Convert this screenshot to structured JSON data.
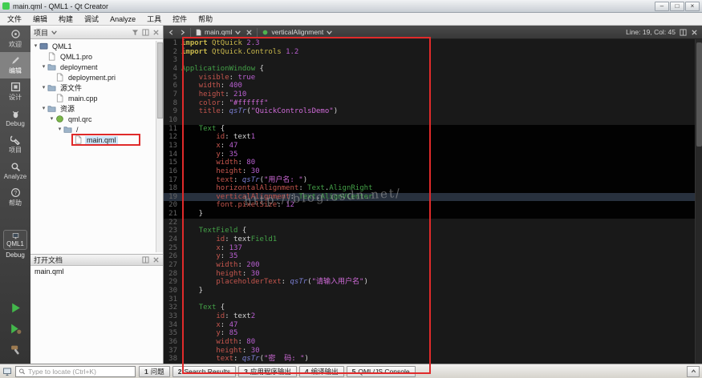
{
  "window": {
    "title": "main.qml - QML1 - Qt Creator",
    "controls": {
      "minimize": "–",
      "maximize": "□",
      "close": "×"
    }
  },
  "colors": {
    "annotation_red": "#e02a2a",
    "qt_green": "#41cd52"
  },
  "menu": {
    "items": [
      "文件",
      "编辑",
      "构建",
      "调试",
      "Analyze",
      "工具",
      "控件",
      "帮助"
    ]
  },
  "modebar": {
    "items": [
      {
        "id": "welcome",
        "label": "欢迎",
        "icon": "welcome",
        "selected": false
      },
      {
        "id": "edit",
        "label": "编辑",
        "icon": "edit",
        "selected": true
      },
      {
        "id": "design",
        "label": "设计",
        "icon": "design",
        "selected": false
      },
      {
        "id": "debug",
        "label": "Debug",
        "icon": "debug",
        "selected": false
      },
      {
        "id": "projects",
        "label": "项目",
        "icon": "projects",
        "selected": false
      },
      {
        "id": "analyze",
        "label": "Analyze",
        "icon": "analyze",
        "selected": false
      },
      {
        "id": "help",
        "label": "帮助",
        "icon": "help",
        "selected": false
      }
    ],
    "kit": {
      "project": "QML1",
      "config": "Debug"
    }
  },
  "project_panel": {
    "title": "项目",
    "tree": [
      {
        "label": "QML1",
        "depth": 0,
        "icon": "project",
        "expanded": true
      },
      {
        "label": "QML1.pro",
        "depth": 1,
        "icon": "file"
      },
      {
        "label": "deployment",
        "depth": 1,
        "icon": "folder",
        "expanded": true
      },
      {
        "label": "deployment.pri",
        "depth": 2,
        "icon": "file"
      },
      {
        "label": "源文件",
        "depth": 1,
        "icon": "folder",
        "expanded": true
      },
      {
        "label": "main.cpp",
        "depth": 2,
        "icon": "file"
      },
      {
        "label": "资源",
        "depth": 1,
        "icon": "folder",
        "expanded": true
      },
      {
        "label": "qml.qrc",
        "depth": 2,
        "icon": "qrc",
        "expanded": true
      },
      {
        "label": "/",
        "depth": 3,
        "icon": "folder",
        "expanded": true
      },
      {
        "label": "main.qml",
        "depth": 4,
        "icon": "file",
        "selected": true,
        "annotated": true
      }
    ],
    "open_docs": {
      "title": "打开文档",
      "items": [
        "main.qml"
      ]
    }
  },
  "editor": {
    "toolbar": {
      "file": "main.qml",
      "symbol": "verticalAlignment",
      "position": "Line: 19, Col: 45"
    },
    "current_line": 19,
    "highlight_block": {
      "from": 11,
      "to": 21
    },
    "watermark": "http://blog.csdn.net/",
    "lines": [
      "import QtQuick 2.3",
      "import QtQuick.Controls 1.2",
      "",
      "ApplicationWindow {",
      "    visible: true",
      "    width: 400",
      "    height: 210",
      "    color: \"#ffffff\"",
      "    title: qsTr(\"QuickControlsDemo\")",
      "",
      "    Text {",
      "        id: text1",
      "        x: 47",
      "        y: 35",
      "        width: 80",
      "        height: 30",
      "        text: qsTr(\"用户名: \")",
      "        horizontalAlignment: Text.AlignRight",
      "        verticalAlignment: Text.AlignVCenter",
      "        font.pixelSize: 12",
      "    }",
      "",
      "    TextField {",
      "        id: textField1",
      "        x: 137",
      "        y: 35",
      "        width: 200",
      "        height: 30",
      "        placeholderText: qsTr(\"请输入用户名\")",
      "    }",
      "",
      "    Text {",
      "        id: text2",
      "        x: 47",
      "        y: 85",
      "        width: 80",
      "        height: 30",
      "        text: qsTr(\"密  码: \")"
    ]
  },
  "statusbar": {
    "locator_placeholder": "Type to locate (Ctrl+K)",
    "panes": [
      {
        "num": "1",
        "name": "issues",
        "label": "问题"
      },
      {
        "num": "2",
        "name": "search-results",
        "label": "Search Results"
      },
      {
        "num": "3",
        "name": "application-output",
        "label": "应用程序输出"
      },
      {
        "num": "4",
        "name": "compile-output",
        "label": "编译输出"
      },
      {
        "num": "5",
        "name": "qml-js-console",
        "label": "QML/JS Console"
      }
    ]
  }
}
